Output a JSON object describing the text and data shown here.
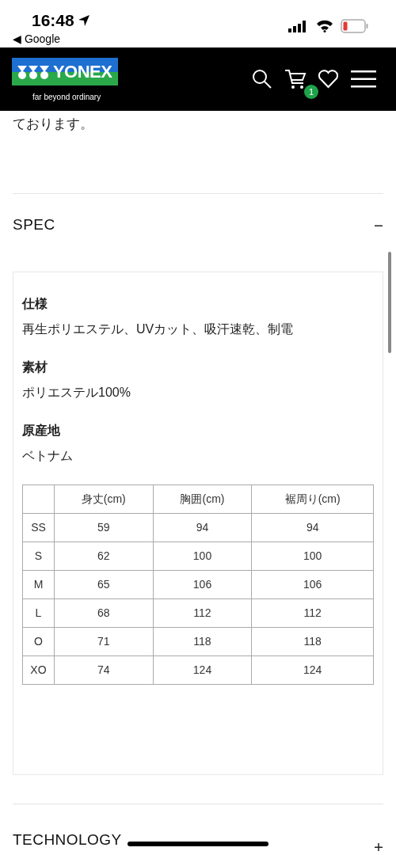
{
  "status_bar": {
    "time": "16:48",
    "back_label": "◀ Google"
  },
  "header": {
    "logo_text": "YONEX",
    "tagline": "far beyond ordinary",
    "cart_count": "1"
  },
  "intro_text": "ております。",
  "sections": [
    {
      "title": "SPEC",
      "expanded": true,
      "specs": [
        {
          "label": "仕様",
          "value": "再生ポリエステル、UVカット、吸汗速乾、制電"
        },
        {
          "label": "素材",
          "value": "ポリエステル100%"
        },
        {
          "label": "原産地",
          "value": "ベトナム"
        }
      ],
      "table": {
        "columns": [
          "",
          "身丈(cm)",
          "胸囲(cm)",
          "裾周り(cm)"
        ],
        "rows": [
          [
            "SS",
            "59",
            "94",
            "94"
          ],
          [
            "S",
            "62",
            "100",
            "100"
          ],
          [
            "M",
            "65",
            "106",
            "106"
          ],
          [
            "L",
            "68",
            "112",
            "112"
          ],
          [
            "O",
            "71",
            "118",
            "118"
          ],
          [
            "XO",
            "74",
            "124",
            "124"
          ]
        ]
      }
    },
    {
      "title": "TECHNOLOGY",
      "expanded": false
    }
  ]
}
